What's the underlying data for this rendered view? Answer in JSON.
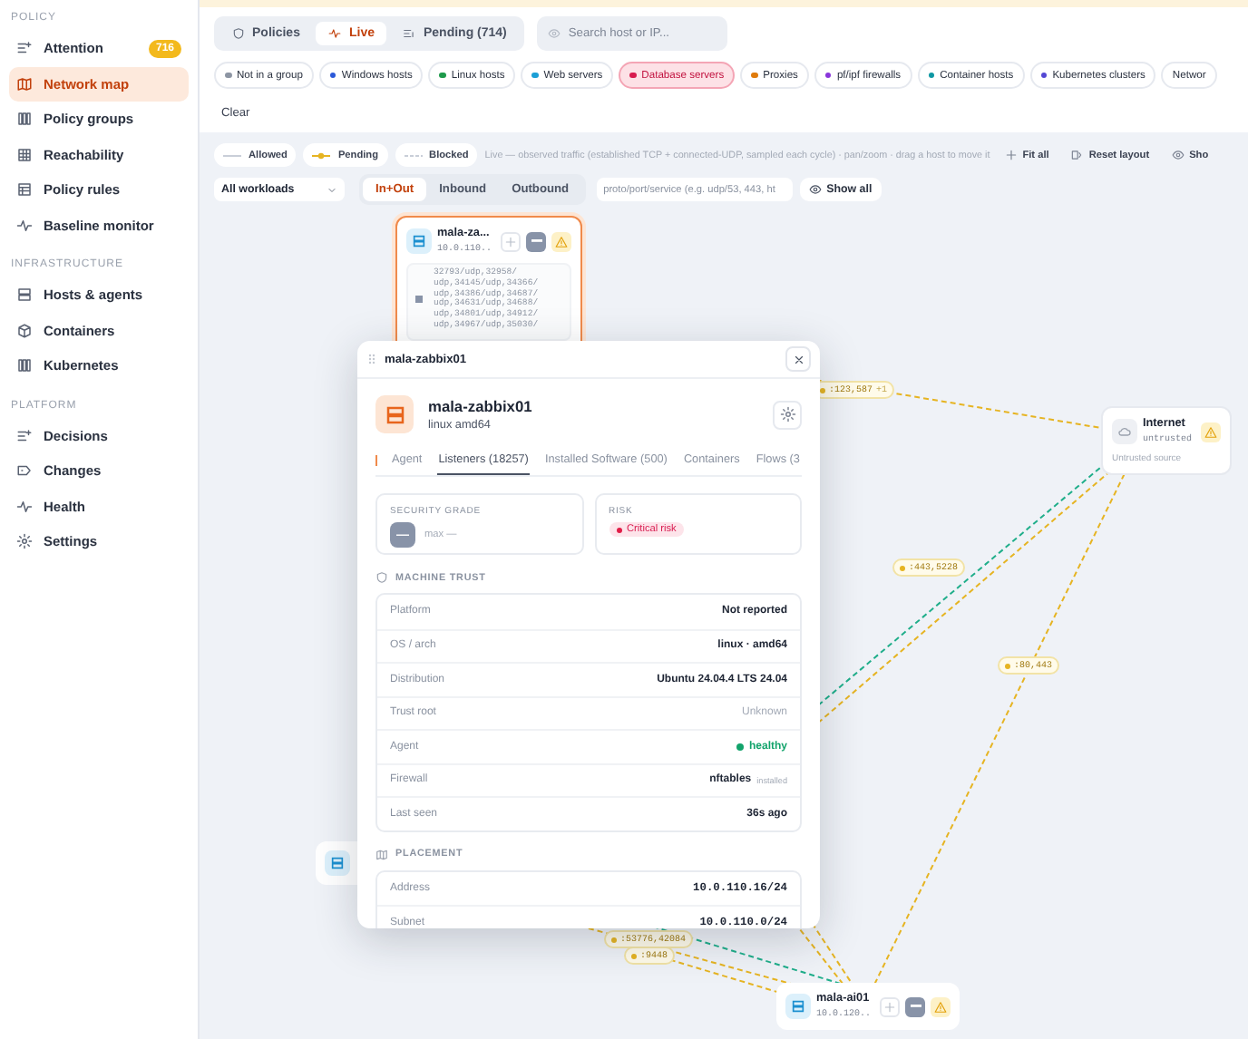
{
  "sidebar": {
    "sections": [
      {
        "title": "POLICY",
        "items": [
          {
            "label": "Attention",
            "selected": false,
            "badge": "716"
          },
          {
            "label": "Network map",
            "selected": true
          },
          {
            "label": "Policy groups",
            "selected": false
          },
          {
            "label": "Reachability",
            "selected": false
          },
          {
            "label": "Policy rules",
            "selected": false
          },
          {
            "label": "Baseline monitor",
            "selected": false
          }
        ]
      },
      {
        "title": "INFRASTRUCTURE",
        "items": [
          {
            "label": "Hosts & agents",
            "selected": false
          },
          {
            "label": "Containers",
            "selected": false
          },
          {
            "label": "Kubernetes",
            "selected": false
          }
        ]
      },
      {
        "title": "PLATFORM",
        "items": [
          {
            "label": "Decisions",
            "selected": false
          },
          {
            "label": "Changes",
            "selected": false
          },
          {
            "label": "Health",
            "selected": false
          },
          {
            "label": "Settings",
            "selected": false
          }
        ]
      }
    ]
  },
  "toolbar": {
    "modes": [
      {
        "label": "Policies",
        "selected": false
      },
      {
        "label": "Live",
        "selected": true
      },
      {
        "label": "Pending (714)",
        "selected": false
      }
    ],
    "search": {
      "placeholder": "Search host or IP..."
    },
    "groups": [
      {
        "label": "Not in a group",
        "color": "#8d95a3",
        "selected": false
      },
      {
        "label": "Windows hosts",
        "color": "#2b59d9",
        "selected": false
      },
      {
        "label": "Linux hosts",
        "color": "#1e9a4b",
        "selected": false
      },
      {
        "label": "Web servers",
        "color": "#1b9fd6",
        "selected": false
      },
      {
        "label": "Database servers",
        "color": "#d81b4f",
        "selected": true
      },
      {
        "label": "Proxies",
        "color": "#e07b0c",
        "selected": false
      },
      {
        "label": "pf/ipf firewalls",
        "color": "#8a36db",
        "selected": false
      },
      {
        "label": "Container hosts",
        "color": "#0f97a3",
        "selected": false
      },
      {
        "label": "Kubernetes clusters",
        "color": "#5448d4",
        "selected": false
      },
      {
        "label": "Networ",
        "selected": false
      }
    ],
    "clear": "Clear"
  },
  "legend": {
    "items": [
      {
        "label": "Allowed",
        "kind": "allowed"
      },
      {
        "label": "Pending",
        "kind": "pending"
      },
      {
        "label": "Blocked",
        "kind": "blocked"
      }
    ],
    "hint": "Live — observed traffic (established TCP + connected-UDP, sampled each cycle) · pan/zoom · drag a host to move it",
    "actions": [
      "Fit all",
      "Reset layout",
      "Sho"
    ]
  },
  "filters": {
    "workload": "All workloads",
    "directions": [
      {
        "label": "In+Out",
        "selected": true
      },
      {
        "label": "Inbound",
        "selected": false
      },
      {
        "label": "Outbound",
        "selected": false
      }
    ],
    "port_filter": {
      "placeholder": "proto/port/service (e.g. udp/53, 443, ht"
    },
    "show_all": "Show all"
  },
  "map": {
    "nodes": [
      {
        "kind": "host",
        "name": "mala-za...",
        "ip": "10.0.110..",
        "selected": true,
        "listeners": [
          "32793/udp,32958/",
          "udp,34145/udp,34366/",
          "udp,34386/udp,34687/",
          "udp,34631/udp,34688/",
          "udp,34801/udp,34912/",
          "udp,34967/udp,35030/"
        ]
      },
      {
        "kind": "internet",
        "name": "Internet",
        "ip": "untrusted",
        "note": "Untrusted source",
        "selected": false
      },
      {
        "kind": "host",
        "name": "mala-ai01",
        "ip": "10.0.120..",
        "selected": false
      },
      {
        "kind": "stub",
        "selected": false
      }
    ],
    "edge_labels": [
      {
        "text": ":123,587",
        "extra": "+1"
      },
      {
        "text": ":443,5228"
      },
      {
        "text": ":80,443"
      },
      {
        "text": ":53776,42084"
      },
      {
        "text": ":9448"
      }
    ]
  },
  "dialog": {
    "title": "mala-zabbix01",
    "host": {
      "name": "mala-zabbix01",
      "subtitle": "linux amd64"
    },
    "tabs": [
      {
        "label": "Agent",
        "selected": false
      },
      {
        "label": "Listeners (18257)",
        "selected": true
      },
      {
        "label": "Installed Software (500)",
        "selected": false
      },
      {
        "label": "Containers",
        "selected": false
      },
      {
        "label": "Flows (3",
        "selected": false
      }
    ],
    "security": {
      "label": "SECURITY GRADE",
      "grade": "—",
      "max": "max —"
    },
    "risk": {
      "label": "RISK",
      "value": "Critical risk"
    },
    "sections": [
      {
        "title": "MACHINE TRUST",
        "rows": [
          {
            "label": "Platform",
            "value": "Not reported",
            "kind": "text"
          },
          {
            "label": "OS / arch",
            "value": "linux · amd64",
            "kind": "text"
          },
          {
            "label": "Distribution",
            "value": "Ubuntu 24.04.4 LTS 24.04",
            "kind": "text"
          },
          {
            "label": "Trust root",
            "value": "Unknown",
            "kind": "muted"
          },
          {
            "label": "Agent",
            "value": "healthy",
            "kind": "status"
          },
          {
            "label": "Firewall",
            "value": "nftables",
            "note": "installed",
            "kind": "text"
          },
          {
            "label": "Last seen",
            "value": "36s ago",
            "kind": "text"
          }
        ]
      },
      {
        "title": "PLACEMENT",
        "rows": [
          {
            "label": "Address",
            "value": "10.0.110.16/24",
            "kind": "mono"
          },
          {
            "label": "Subnet",
            "value": "10.0.110.0/24",
            "kind": "mono"
          }
        ]
      }
    ]
  }
}
